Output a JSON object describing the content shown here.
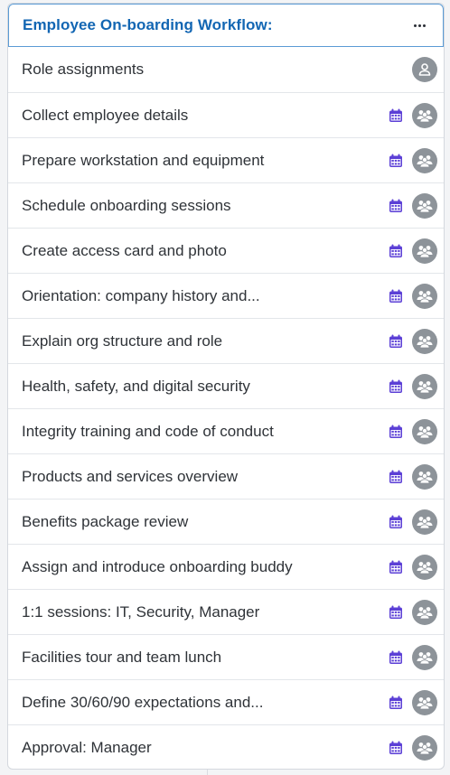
{
  "workflow": {
    "title": "Employee On-boarding Workflow:",
    "menu_icon": "more-horizontal-icon"
  },
  "colors": {
    "title": "#1266b3",
    "calendar": "#5b3fd6",
    "avatar": "#8d9399",
    "header_border": "#5b9bd5"
  },
  "rows": [
    {
      "label": "Role assignments",
      "calendar": false,
      "avatar": "person-icon"
    },
    {
      "label": "Collect employee details",
      "calendar": true,
      "avatar": "people-icon"
    },
    {
      "label": "Prepare workstation and equipment",
      "calendar": true,
      "avatar": "people-icon"
    },
    {
      "label": "Schedule onboarding sessions",
      "calendar": true,
      "avatar": "people-icon"
    },
    {
      "label": "Create access card and photo",
      "calendar": true,
      "avatar": "people-icon"
    },
    {
      "label": "Orientation: company history and...",
      "calendar": true,
      "avatar": "people-icon"
    },
    {
      "label": "Explain org structure and role",
      "calendar": true,
      "avatar": "people-icon"
    },
    {
      "label": "Health, safety, and digital security",
      "calendar": true,
      "avatar": "people-icon"
    },
    {
      "label": "Integrity training and code of conduct",
      "calendar": true,
      "avatar": "people-icon"
    },
    {
      "label": "Products and services overview",
      "calendar": true,
      "avatar": "people-icon"
    },
    {
      "label": "Benefits package review",
      "calendar": true,
      "avatar": "people-icon"
    },
    {
      "label": "Assign and introduce onboarding buddy",
      "calendar": true,
      "avatar": "people-icon"
    },
    {
      "label": "1:1 sessions: IT, Security, Manager",
      "calendar": true,
      "avatar": "people-icon"
    },
    {
      "label": "Facilities tour and team lunch",
      "calendar": true,
      "avatar": "people-icon"
    },
    {
      "label": "Define 30/60/90 expectations and...",
      "calendar": true,
      "avatar": "people-icon"
    },
    {
      "label": "Approval: Manager",
      "calendar": true,
      "avatar": "people-icon"
    }
  ]
}
